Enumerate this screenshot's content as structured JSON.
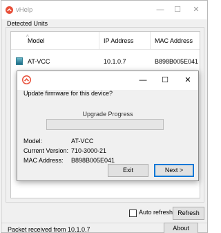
{
  "window": {
    "title": "vHelp",
    "minimize_glyph": "—",
    "maximize_glyph": "☐",
    "close_glyph": "✕",
    "icon": "avocent-logo-icon"
  },
  "group": {
    "label": "Detected Units"
  },
  "table": {
    "columns": [
      "Model",
      "IP Address",
      "MAC Address"
    ],
    "rows": [
      {
        "model": "AT-VCC",
        "ip": "10.1.0.7",
        "mac": "B898B005E041"
      }
    ]
  },
  "dialog": {
    "prompt": "Update firmware for this device?",
    "progress_label": "Upgrade Progress",
    "progress": 0,
    "fields": [
      {
        "label": "Model:",
        "value": "AT-VCC"
      },
      {
        "label": "Current Version:",
        "value": "710-3000-21"
      },
      {
        "label": "MAC Address:",
        "value": "B898B005E041"
      }
    ],
    "exit_label": "Exit",
    "next_label": "Next >",
    "minimize_glyph": "—",
    "maximize_glyph": "☐",
    "close_glyph": "✕"
  },
  "footer": {
    "auto_refresh_label": "Auto refresh",
    "auto_refresh_checked": false,
    "refresh_label": "Refresh",
    "about_label": "About",
    "status": "Packet received from 10.1.0.7"
  },
  "colors": {
    "accent": "#0078d7",
    "logo": "#e8503a"
  }
}
